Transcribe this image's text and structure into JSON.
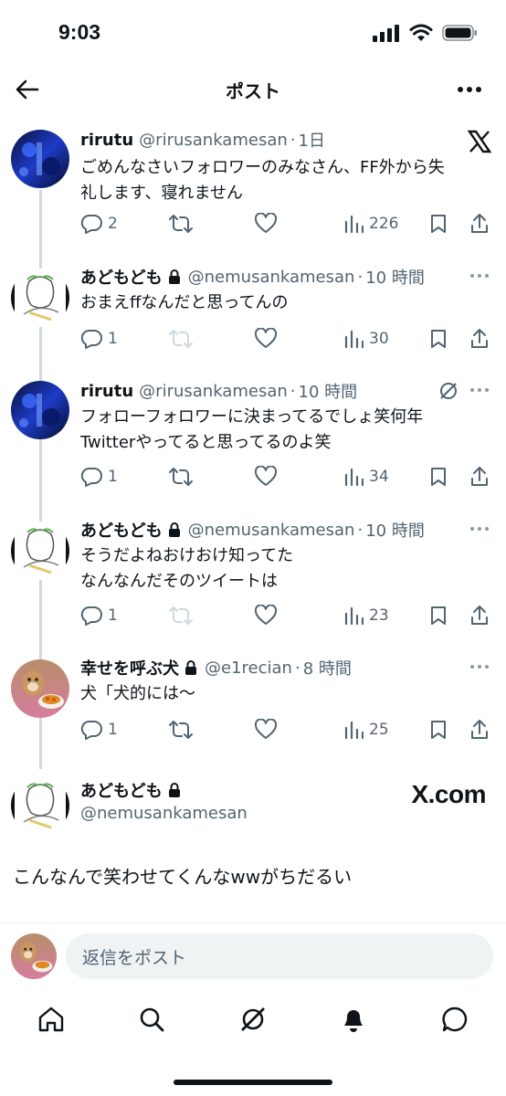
{
  "status_bar": {
    "time": "9:03"
  },
  "header": {
    "title": "ポスト"
  },
  "posts": [
    {
      "name": "rirutu",
      "handle": "@rirusankamesan",
      "time": "1日",
      "text": "ごめんなさいフォロワーのみなさん、FF外から失\n礼します、寝れません",
      "replies": "2",
      "reposts": "",
      "likes": "",
      "views": "226"
    },
    {
      "name": "あどもども",
      "handle": "@nemusankamesan",
      "time": "10 時間",
      "text": "おまえffなんだと思ってんの",
      "replies": "1",
      "reposts": "",
      "likes": "",
      "views": "30"
    },
    {
      "name": "rirutu",
      "handle": "@rirusankamesan",
      "time": "10 時間",
      "text": "フォローフォロワーに決まってるでしょ笑何年\nTwitterやってると思ってるのよ笑",
      "replies": "1",
      "reposts": "",
      "likes": "",
      "views": "34"
    },
    {
      "name": "あどもども",
      "handle": "@nemusankamesan",
      "time": "10 時間",
      "text": "そうだよねおけおけ知ってた\nなんなんだそのツイートは",
      "replies": "1",
      "reposts": "",
      "likes": "",
      "views": "23"
    },
    {
      "name": "幸せを呼ぶ犬",
      "handle": "@e1recian",
      "time": "8 時間",
      "text": "犬「犬的には〜",
      "replies": "1",
      "reposts": "",
      "likes": "",
      "views": "25"
    }
  ],
  "main_post": {
    "name": "あどもども",
    "handle": "@nemusankamesan",
    "watermark": "X.com",
    "text": "こんなんで笑わせてくんなwwがちだるい"
  },
  "reply_bar": {
    "placeholder": "返信をポスト"
  },
  "colors": {
    "text": "#0f1419",
    "secondary": "#536471",
    "thread_line": "#cfd9de",
    "input_bg": "#eff3f4"
  },
  "icons": {
    "header": [
      "back-arrow-icon",
      "more-icon"
    ],
    "actions": [
      "reply-icon",
      "repost-icon",
      "like-icon",
      "views-icon",
      "bookmark-icon",
      "share-icon"
    ],
    "tabs": [
      "home-icon",
      "search-icon",
      "grok-icon",
      "notifications-icon",
      "messages-icon"
    ]
  }
}
